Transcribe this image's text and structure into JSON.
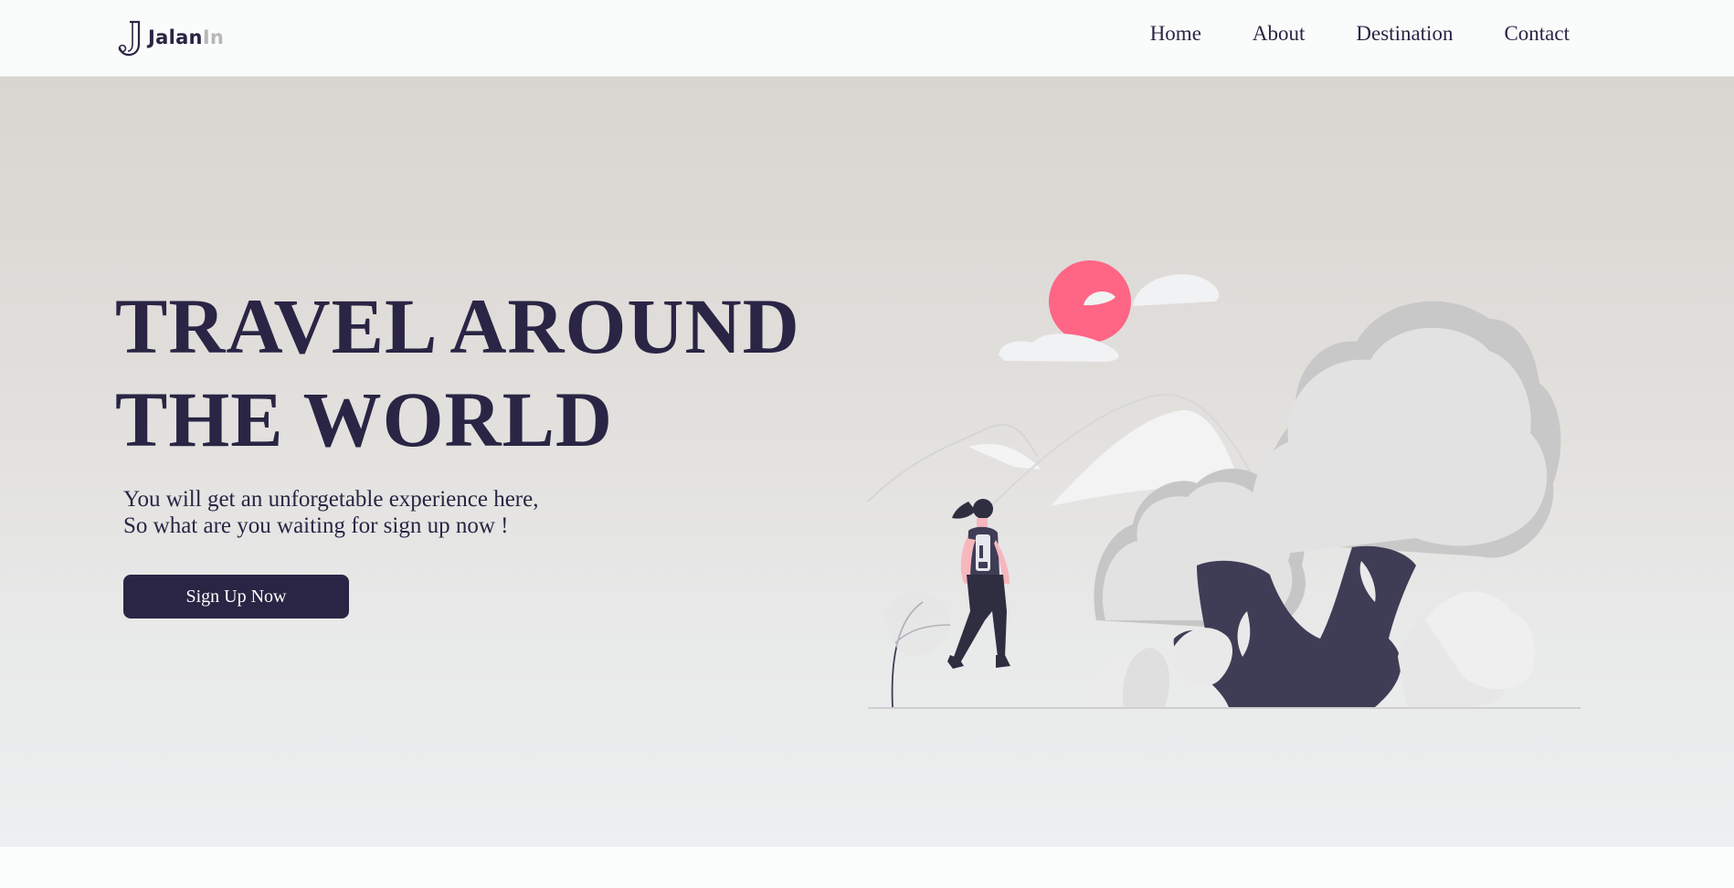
{
  "brand": {
    "name_part1": "Jalan",
    "name_part2": "In",
    "logo_icon": "j-letter-icon"
  },
  "nav": {
    "items": [
      {
        "label": "Home"
      },
      {
        "label": "About"
      },
      {
        "label": "Destination"
      },
      {
        "label": "Contact"
      }
    ]
  },
  "hero": {
    "title_line1": "TRAVEL AROUND",
    "title_line2": "THE WORLD",
    "subtitle_line1": "You will get an unforgetable experience here,",
    "subtitle_line2": "So what are you waiting for sign up now !",
    "cta_label": "Sign Up Now",
    "illustration_icon": "traveler-illustration-icon"
  },
  "colors": {
    "primary": "#2a2544",
    "accent": "#ff6584",
    "background_top": "#d9d5d0",
    "background_bottom": "#edeff0",
    "tree_gray": "#e2e2e2"
  }
}
